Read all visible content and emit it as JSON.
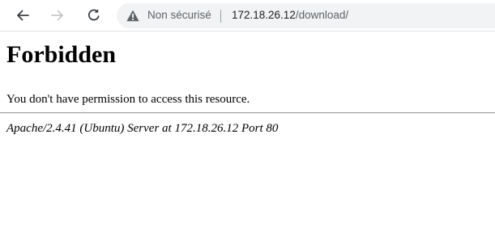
{
  "browser": {
    "security_label": "Non sécurisé",
    "url_host": "172.18.26.12",
    "url_path": "/download/",
    "icons": {
      "back": "arrow-left-icon",
      "forward": "arrow-right-icon",
      "reload": "reload-icon",
      "security": "warning-triangle-icon"
    }
  },
  "page": {
    "title": "Forbidden",
    "message": "You don't have permission to access this resource.",
    "server_signature": "Apache/2.4.41 (Ubuntu) Server at 172.18.26.12 Port 80"
  }
}
